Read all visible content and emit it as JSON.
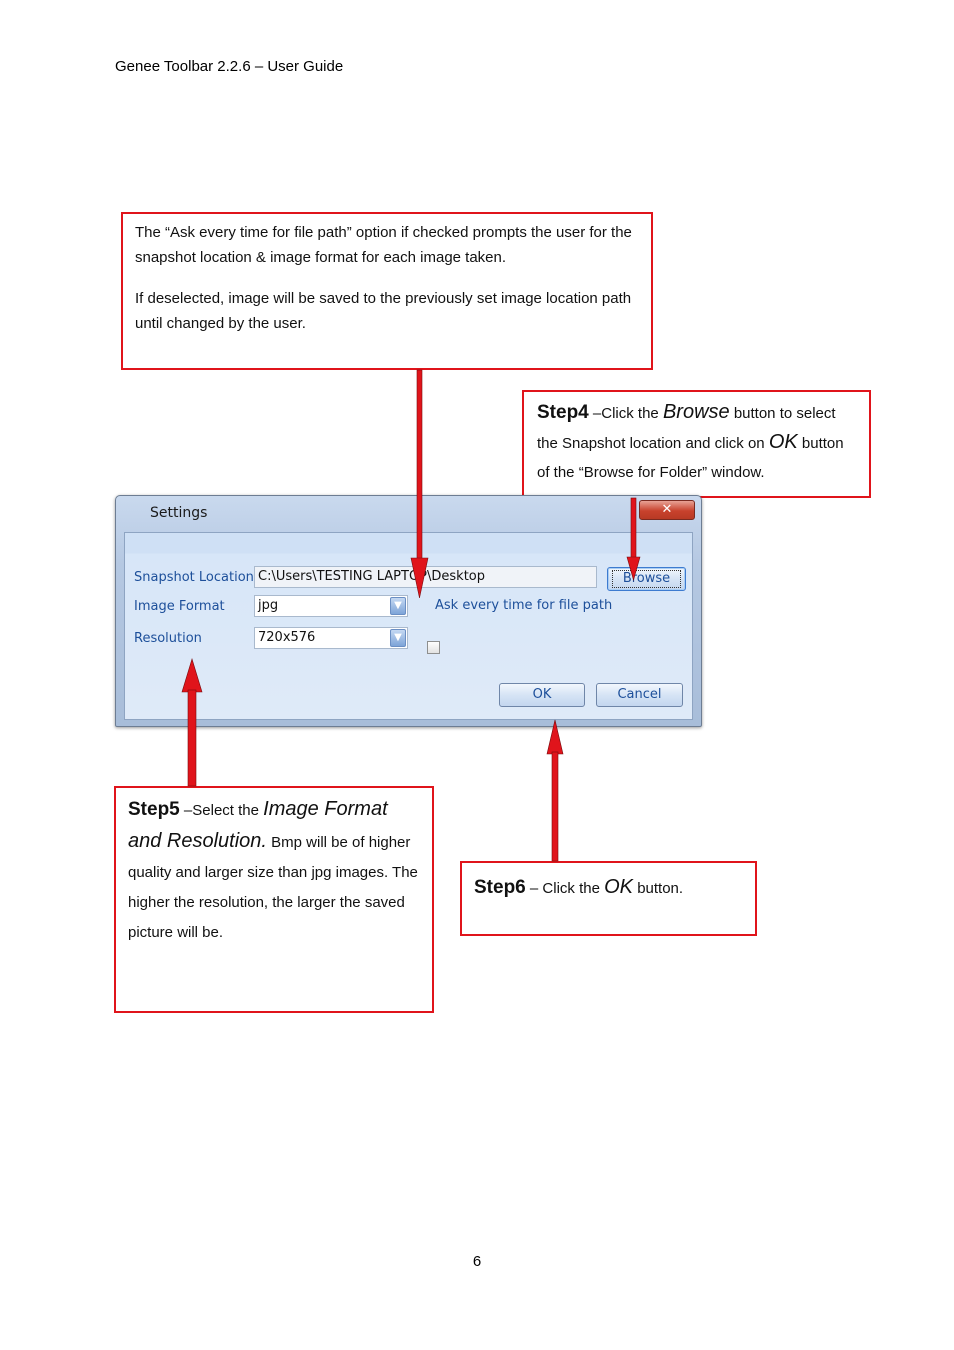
{
  "header": {
    "title": "Genee Toolbar 2.2.6 – User Guide"
  },
  "page_number": "6",
  "callouts": {
    "ask_path": {
      "para1": "The “Ask every time for file path” option if checked prompts the user for the snapshot location & image format for each image taken.",
      "para2": "If deselected, image will be saved to the previously set image location path until changed by the user."
    },
    "step4": {
      "label": "Step4",
      "text1": " –Click the ",
      "em1": "Browse",
      "text2": " button to select the Snapshot location and click on ",
      "em2": "OK",
      "text3": " button of the “Browse for Folder” window."
    },
    "step5": {
      "label": "Step5",
      "text1": " –Select the ",
      "em1": "Image Format and Resolution.",
      "text2": " Bmp will be of higher quality and larger size than jpg images.  The higher the resolution, the larger the saved picture will be."
    },
    "step6": {
      "label": "Step6",
      "text1": " – Click the ",
      "em1": "OK",
      "text2": " button."
    }
  },
  "dialog": {
    "title": "Settings",
    "close_glyph": "✕",
    "snapshot_location": {
      "label": "Snapshot Location",
      "value": "C:\\Users\\TESTING LAPTOP\\Desktop"
    },
    "image_format": {
      "label": "Image Format",
      "value": "jpg"
    },
    "resolution": {
      "label": "Resolution",
      "value": "720x576"
    },
    "ask_checkbox": {
      "label": "Ask every time for file path",
      "checked": false
    },
    "browse_label": "Browse",
    "ok_label": "OK",
    "cancel_label": "Cancel"
  },
  "colors": {
    "callout_border": "#e0141b",
    "arrow": "#e0141b",
    "dialog_label": "#1d4f9a"
  }
}
